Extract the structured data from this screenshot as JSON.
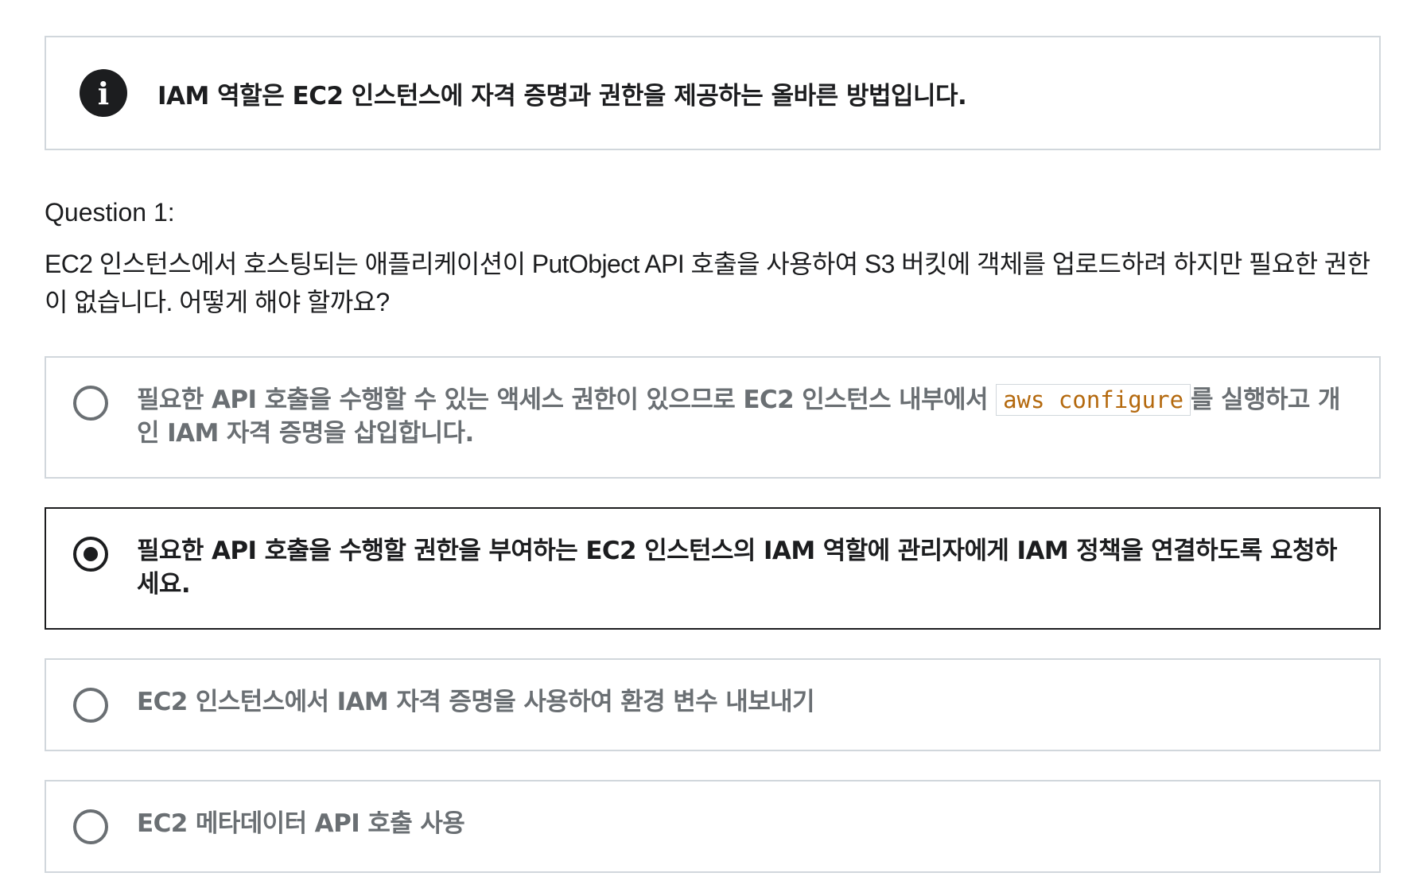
{
  "feedback": {
    "icon": "info-icon",
    "icon_glyph": "i",
    "text": "IAM 역할은 EC2 인스턴스에 자격 증명과 권한을 제공하는 올바른 방법입니다."
  },
  "question": {
    "label": "Question 1:",
    "text": "EC2 인스턴스에서 호스팅되는 애플리케이션이 PutObject API 호출을 사용하여 S3 버킷에 객체를 업로드하려 하지만 필요한 권한이 없습니다. 어떻게 해야 할까요?"
  },
  "answers": [
    {
      "selected": false,
      "text_before": "필요한 API 호출을 수행할 수 있는 액세스 권한이 있으므로 EC2 인스턴스 내부에서 ",
      "code": "aws configure",
      "text_after": "를 실행하고 개인 IAM 자격 증명을 삽입합니다."
    },
    {
      "selected": true,
      "text": "필요한 API 호출을 수행할 권한을 부여하는 EC2 인스턴스의 IAM 역할에 관리자에게 IAM 정책을 연결하도록 요청하세요."
    },
    {
      "selected": false,
      "text": "EC2 인스턴스에서 IAM 자격 증명을 사용하여 환경 변수 내보내기"
    },
    {
      "selected": false,
      "text": "EC2 메타데이터 API 호출 사용"
    }
  ],
  "colors": {
    "text_dark": "#1c1d1f",
    "text_muted": "#6a6f73",
    "border": "#d1d7dc",
    "code": "#b4690e"
  }
}
